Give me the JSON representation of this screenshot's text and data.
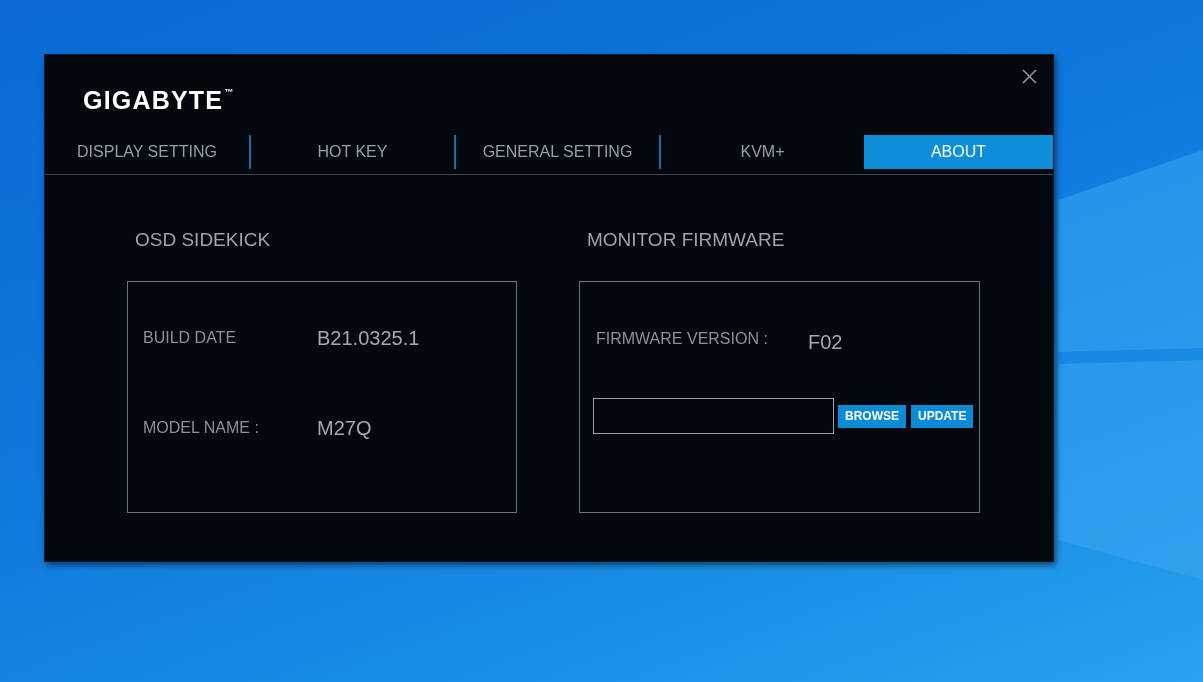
{
  "window": {
    "logo": "GIGABYTE$^{™}$"
  },
  "tabs": [
    {
      "label": "DISPLAY SETTING",
      "selected": false
    },
    {
      "label": "HOT KEY",
      "selected": false
    },
    {
      "label": "GENERAL SETTING",
      "selected": false
    },
    {
      "label": "KVM+",
      "selected": false
    },
    {
      "label": "ABOUT",
      "selected": true
    }
  ],
  "sections": [
    {
      "kind": "info",
      "title": "OSD SIDEKICK",
      "fields": [
        {
          "label": "BUILD DATE",
          "value": "B21.0325.1"
        },
        {
          "label": "MODEL NAME :",
          "value": "M27Q"
        }
      ]
    },
    {
      "kind": "update",
      "title": "MONITOR FIRMWARE",
      "fields": [
        {
          "label": "FIRMWARE VERSION :",
          "value": "F02"
        }
      ],
      "buttons": [
        "BROWSE",
        "UPDATE"
      ]
    }
  ]
}
